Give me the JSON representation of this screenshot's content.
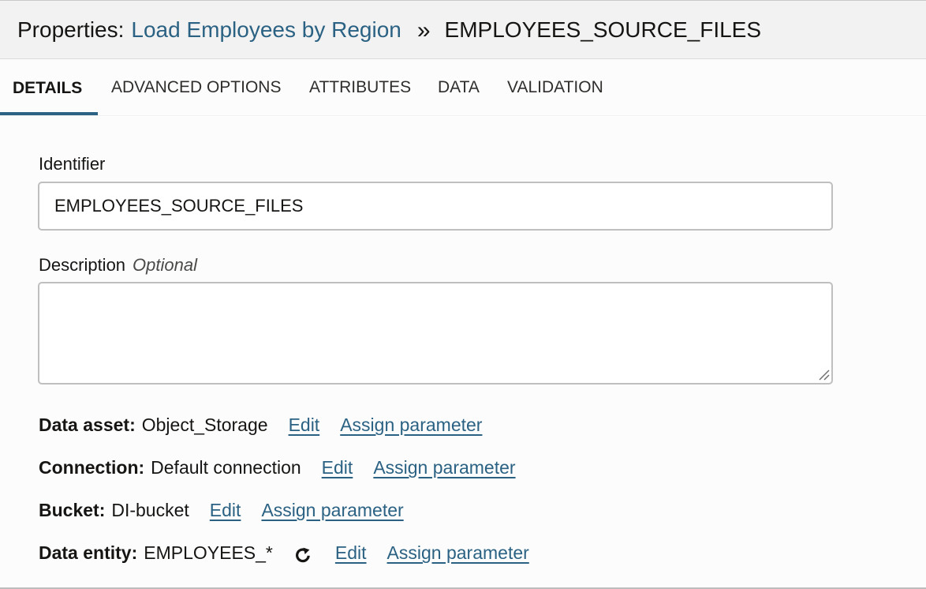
{
  "header": {
    "prefix": "Properties:",
    "parent_link": "Load Employees by Region",
    "separator": "»",
    "current": "EMPLOYEES_SOURCE_FILES"
  },
  "tabs": [
    {
      "label": "DETAILS",
      "active": true
    },
    {
      "label": "ADVANCED OPTIONS",
      "active": false
    },
    {
      "label": "ATTRIBUTES",
      "active": false
    },
    {
      "label": "DATA",
      "active": false
    },
    {
      "label": "VALIDATION",
      "active": false
    }
  ],
  "form": {
    "identifier_label": "Identifier",
    "identifier_value": "EMPLOYEES_SOURCE_FILES",
    "description_label": "Description",
    "description_optional": "Optional",
    "description_value": ""
  },
  "properties": [
    {
      "key": "Data asset:",
      "value": "Object_Storage",
      "edit": "Edit",
      "assign": "Assign parameter",
      "refresh": false
    },
    {
      "key": "Connection:",
      "value": "Default connection",
      "edit": "Edit",
      "assign": "Assign parameter",
      "refresh": false
    },
    {
      "key": "Bucket:",
      "value": "DI-bucket",
      "edit": "Edit",
      "assign": "Assign parameter",
      "refresh": false
    },
    {
      "key": "Data entity:",
      "value": "EMPLOYEES_*",
      "edit": "Edit",
      "assign": "Assign parameter",
      "refresh": true
    }
  ],
  "colors": {
    "link": "#2b6283",
    "tab_underline": "#2c6283",
    "header_bg": "#f2f2f2"
  },
  "icons": {
    "refresh": "refresh-icon",
    "resize": "resize-grip-icon"
  }
}
